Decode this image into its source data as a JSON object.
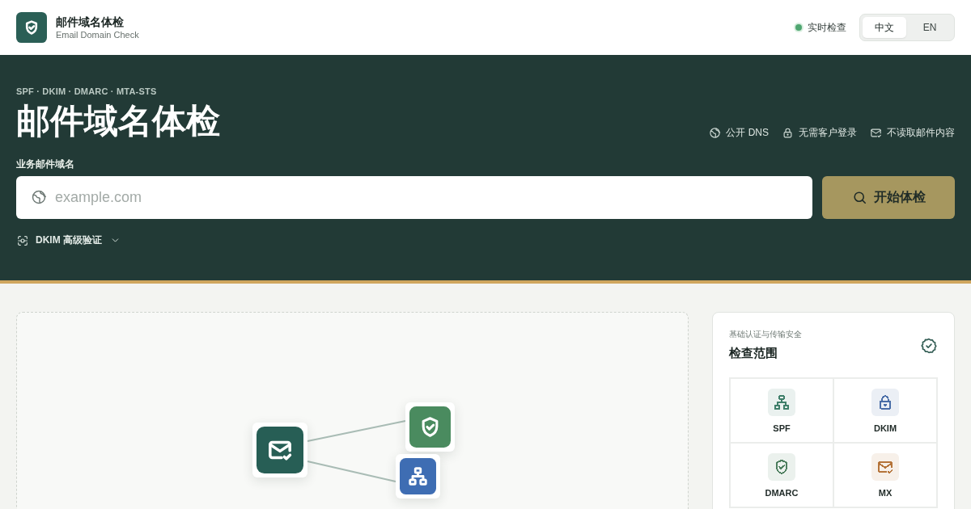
{
  "header": {
    "app_title": "邮件域名体检",
    "app_subtitle": "Email Domain Check",
    "status": {
      "label": "实时检查",
      "active": true
    },
    "languages": [
      {
        "label": "中文",
        "selected": true
      },
      {
        "label": "EN",
        "selected": false
      }
    ]
  },
  "hero": {
    "eyebrow": "SPF · DKIM · DMARC · MTA-STS",
    "title": "邮件域名体检",
    "badges": [
      {
        "label": "公开 DNS"
      },
      {
        "label": "无需客户登录"
      },
      {
        "label": "不读取邮件内容"
      }
    ],
    "field": {
      "label": "业务邮件域名",
      "placeholder": "example.com"
    },
    "submit": "开始体检",
    "advanced": {
      "label": "DKIM 高级验证",
      "expanded": false
    }
  },
  "diagram": {
    "nodes": [
      {
        "color": "#275e55"
      },
      {
        "color": "#4a8b5f"
      },
      {
        "color": "#3e6db3"
      }
    ]
  },
  "scope": {
    "subtitle": "基础认证与传输安全",
    "title": "检查范围",
    "items": [
      {
        "label": "SPF",
        "color": "#3f7f6a"
      },
      {
        "label": "DKIM",
        "color": "#4a6ea8"
      },
      {
        "label": "DMARC",
        "color": "#4d7e5e"
      },
      {
        "label": "MX",
        "color": "#b5743a"
      }
    ]
  }
}
